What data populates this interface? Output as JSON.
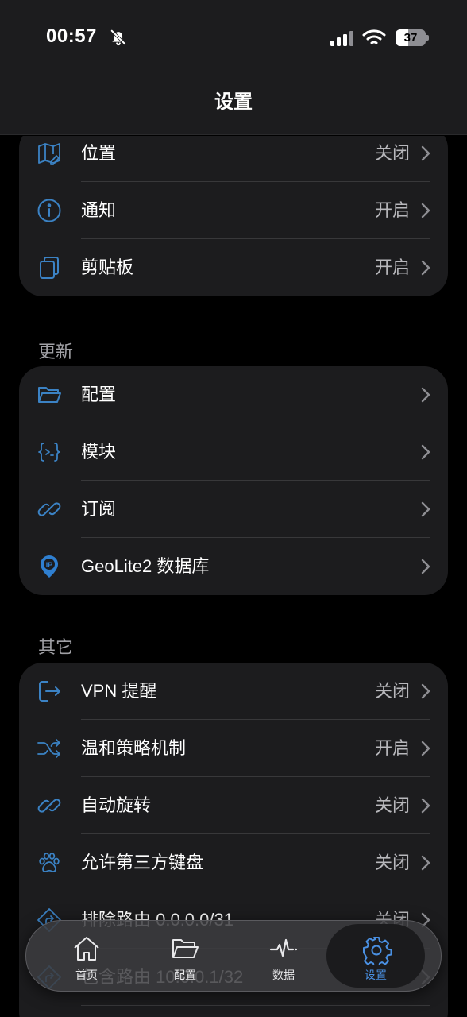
{
  "status_bar": {
    "time": "00:57",
    "battery": "37"
  },
  "nav": {
    "title": "设置"
  },
  "permissions": {
    "items": [
      {
        "label": "位置",
        "value": "关闭",
        "icon": "map-icon"
      },
      {
        "label": "通知",
        "value": "开启",
        "icon": "info-icon"
      },
      {
        "label": "剪贴板",
        "value": "开启",
        "icon": "clipboard-icon"
      }
    ]
  },
  "updates": {
    "header": "更新",
    "items": [
      {
        "label": "配置",
        "icon": "folder-icon"
      },
      {
        "label": "模块",
        "icon": "module-icon"
      },
      {
        "label": "订阅",
        "icon": "link-icon"
      },
      {
        "label": "GeoLite2 数据库",
        "icon": "ip-pin-icon"
      }
    ]
  },
  "others": {
    "header": "其它",
    "items": [
      {
        "label": "VPN 提醒",
        "value": "关闭",
        "icon": "exit-icon"
      },
      {
        "label": "温和策略机制",
        "value": "开启",
        "icon": "shuffle-icon"
      },
      {
        "label": "自动旋转",
        "value": "关闭",
        "icon": "link-icon"
      },
      {
        "label": "允许第三方键盘",
        "value": "关闭",
        "icon": "paw-icon"
      },
      {
        "label": "排除路由 0.0.0.0/31",
        "value": "关闭",
        "icon": "route-icon"
      },
      {
        "label": "包含路由 10.0.0.1/32",
        "value": "",
        "icon": "route-icon"
      }
    ]
  },
  "tab_bar": {
    "tabs": [
      {
        "label": "首页",
        "icon": "home-icon"
      },
      {
        "label": "配置",
        "icon": "folder-icon"
      },
      {
        "label": "数据",
        "icon": "activity-icon"
      },
      {
        "label": "设置",
        "icon": "gear-icon"
      }
    ],
    "active": "设置"
  },
  "colors": {
    "accent": "#4a90e2",
    "card": "#1c1c1e",
    "background": "#000000",
    "secondary_text": "#b8b8bc"
  }
}
